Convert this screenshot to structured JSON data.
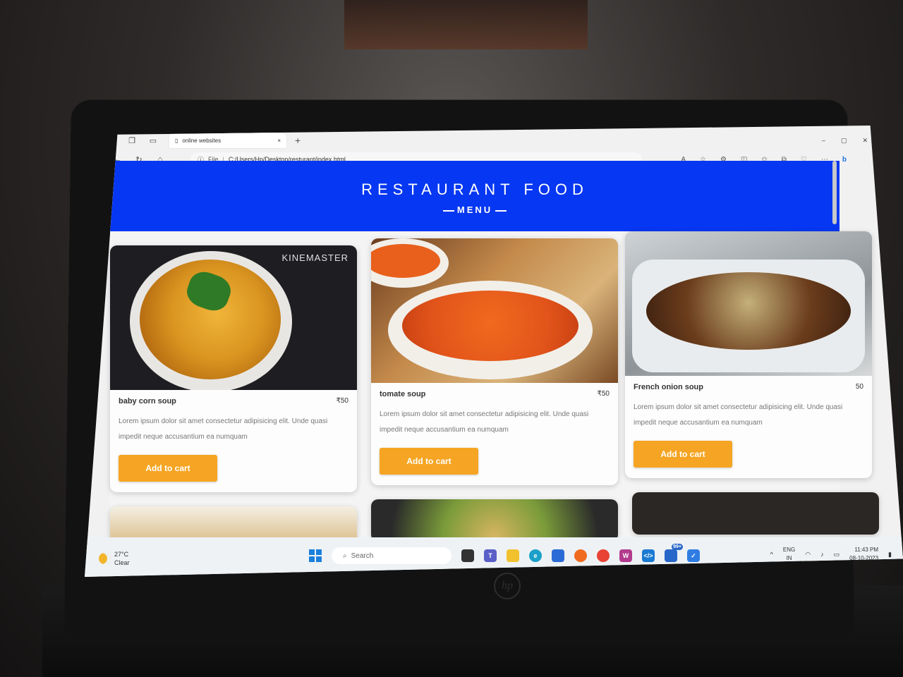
{
  "browser": {
    "tab_title": "online websites",
    "close_glyph": "×",
    "newtab_glyph": "+",
    "address_scheme": "File",
    "address_path": "C:/Users/Hp/Desktop/resturant/index.html",
    "window_controls": [
      "–",
      "▢",
      "✕"
    ]
  },
  "page": {
    "title": "RESTAURANT FOOD",
    "subtitle": "MENU",
    "cards": [
      {
        "name": "baby corn soup",
        "price": "₹50",
        "description": "Lorem ipsum dolor sit amet consectetur adipisicing elit. Unde quasi impedit neque accusantium ea numquam",
        "button": "Add to cart",
        "watermark": "KINEMASTER"
      },
      {
        "name": "tomate soup",
        "price": "₹50",
        "description": "Lorem ipsum dolor sit amet consectetur adipisicing elit. Unde quasi impedit neque accusantium ea numquam",
        "button": "Add to cart"
      },
      {
        "name": "French onion soup",
        "price": "50",
        "description": "Lorem ipsum dolor sit amet consectetur adipisicing elit. Unde quasi impedit neque accusantium ea numquam",
        "button": "Add to cart"
      }
    ]
  },
  "taskbar": {
    "weather_temp": "27°C",
    "weather_text": "Clear",
    "search_placeholder": "Search",
    "lang_top": "ENG",
    "lang_bottom": "IN",
    "time": "11:43 PM",
    "date": "08-10-2023",
    "badge": "99+"
  },
  "colors": {
    "accent": "#0637f2",
    "button": "#f5a523"
  },
  "icons": [
    "profile-icon",
    "collections-icon",
    "tabs-icon",
    "back-icon",
    "refresh-icon",
    "home-icon",
    "info-icon",
    "read-aloud-icon",
    "favorite-icon",
    "extensions-icon",
    "split-screen-icon",
    "favorites-icon",
    "collections-toolbar-icon",
    "browser-essentials-icon",
    "more-icon",
    "bing-icon",
    "windows-icon",
    "search-icon",
    "task-view-icon",
    "teams-icon",
    "file-explorer-icon",
    "edge-icon",
    "store-icon",
    "firefox-icon",
    "chrome-icon",
    "wps-icon",
    "vscode-icon",
    "todo-icon",
    "wifi-icon",
    "volume-icon",
    "battery-icon"
  ]
}
